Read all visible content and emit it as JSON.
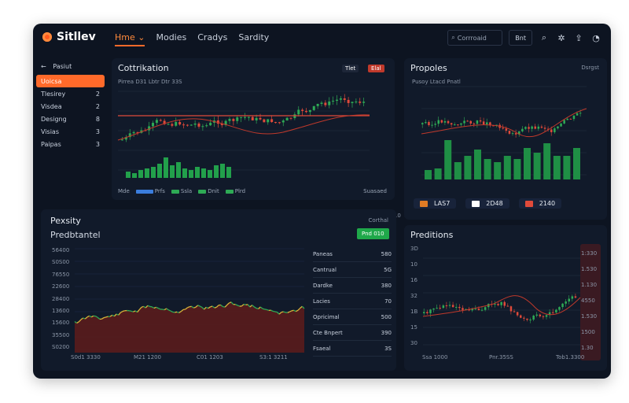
{
  "header": {
    "logo": "Sitllev",
    "nav": [
      "Hme ⌄",
      "Modies",
      "Cradys",
      "Sardity"
    ],
    "search_placeholder": "Corrroaid",
    "button_label": "Bnt"
  },
  "sidebar": {
    "back_label": "Pasiut",
    "items": [
      {
        "label": "Uoicsa",
        "count": ""
      },
      {
        "label": "Tlesirey",
        "count": "2"
      },
      {
        "label": "Visdea",
        "count": "2"
      },
      {
        "label": "Designg",
        "count": "8"
      },
      {
        "label": "Visias",
        "count": "3"
      },
      {
        "label": "Paipas",
        "count": "3"
      }
    ]
  },
  "main_chart": {
    "title": "Cottrikation",
    "subtitle": "Pirrea D31 Lbtr Dtr 33S",
    "badge1": "Tlet",
    "badge2": "Elal",
    "y_ticks": [
      "1SS5",
      "5330",
      "5,330",
      "1SS5",
      "1450",
      "1.00"
    ],
    "x_ticks": [
      "Pae",
      "Tl",
      "Mds",
      "Zo",
      "10",
      "Tar",
      "100",
      "110",
      "180",
      "700",
      "250",
      "2210",
      "1S",
      "1S30",
      "SSS0"
    ],
    "footer_left": "Mde",
    "legend": [
      "Prfs",
      "Ssla",
      "Dnit",
      "Plrd"
    ],
    "footer_right": "Suasaed",
    "price_line_color": "#e04a3a"
  },
  "propoles": {
    "title": "Propoles",
    "right_label": "Dsrgst",
    "subtitle": "Pusoy Ltacd Pnatl",
    "y_ticks": [
      "16",
      "5",
      "E",
      "13",
      "1"
    ],
    "x_ticks": [
      "0",
      "2Al1",
      "3AS",
      "5"
    ],
    "positions": [
      {
        "label": "LAS7",
        "color": "#e07b24"
      },
      {
        "label": "2D48",
        "color": "#ffffff"
      },
      {
        "label": "2140",
        "color": "#e04a3a"
      }
    ]
  },
  "density": {
    "title": "Pexsity",
    "subtitle": "Predbtantel",
    "button": "Pnd 010",
    "header_right": "Corthal",
    "y_ticks": [
      "56400",
      "S0S00",
      "76550",
      "22600",
      "28400",
      "13600",
      "15600",
      "35500",
      "S0200"
    ],
    "x_ticks": [
      "S0d1 3330",
      "M21 1200",
      "C01 1203",
      "S3:1 3211"
    ],
    "table": [
      {
        "label": "Paneas",
        "value": "580"
      },
      {
        "label": "Cantrual",
        "value": "5G"
      },
      {
        "label": "Dardke",
        "value": "380"
      },
      {
        "label": "Lacies",
        "value": "70"
      },
      {
        "label": "Opricimal",
        "value": "500"
      },
      {
        "label": "Cte Bnpert",
        "value": "390"
      },
      {
        "label": "Fsaeal",
        "value": "3S"
      }
    ]
  },
  "predictions": {
    "title": "Preditions",
    "y_ticks": [
      "3D",
      "10",
      "16",
      "32",
      "1B",
      "15",
      "30"
    ],
    "right_ticks": [
      "1:330",
      "1.530",
      "1.130",
      "4550",
      "1.530",
      "1500",
      "1.30"
    ],
    "x_ticks": [
      "Ssa 1000",
      "Pnr.35SS",
      "Tob1.3300"
    ]
  }
}
